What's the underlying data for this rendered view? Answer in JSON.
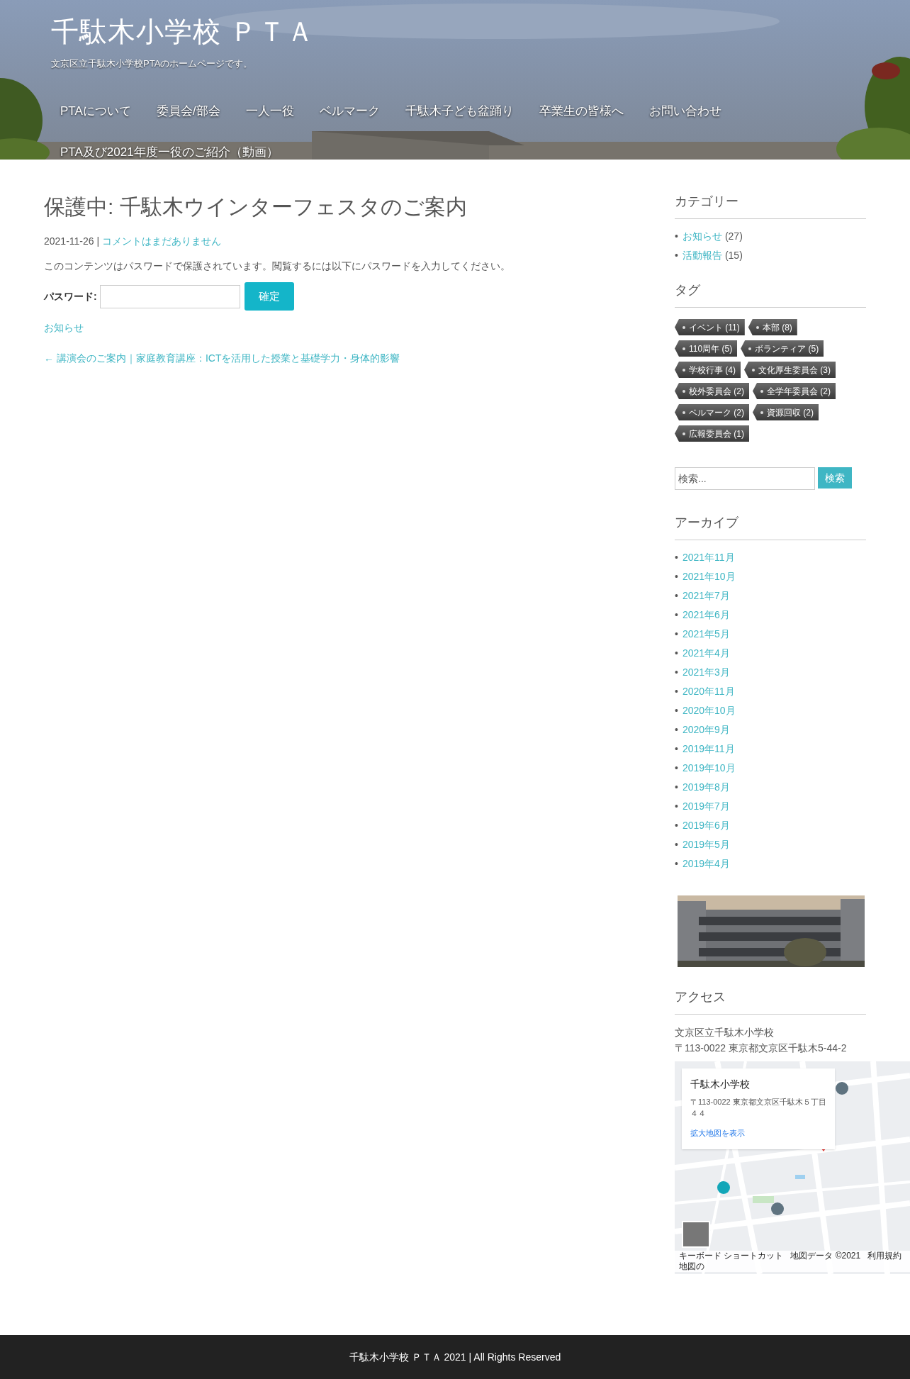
{
  "header": {
    "site_title": "千駄木小学校 ＰＴＡ",
    "tagline": "文京区立千駄木小学校PTAのホームページです。",
    "nav": [
      "PTAについて",
      "委員会/部会",
      "一人一役",
      "ベルマーク",
      "千駄木子ども盆踊り",
      "卒業生の皆様へ",
      "お問い合わせ",
      "PTA及び2021年度一役のご紹介（動画）"
    ]
  },
  "post": {
    "title": "保護中: 千駄木ウインターフェスタのご案内",
    "date": "2021-11-26",
    "separator": "|",
    "comments_link": "コメントはまだありません",
    "protected_notice": "このコンテンツはパスワードで保護されています。閲覧するには以下にパスワードを入力してください。",
    "password_label": "パスワード:",
    "submit_button": "確定",
    "category_link": "お知らせ",
    "prev_post_link": "← 講演会のご案内｜家庭教育講座：ICTを活用した授業と基礎学力・身体的影響"
  },
  "sidebar": {
    "categories": {
      "title": "カテゴリー",
      "bullet": "•",
      "items": [
        {
          "label": "お知らせ",
          "count": "(27)"
        },
        {
          "label": "活動報告",
          "count": "(15)"
        }
      ]
    },
    "tags": {
      "title": "タグ",
      "items": [
        "イベント (11)",
        "本部 (8)",
        "110周年 (5)",
        "ボランティア (5)",
        "学校行事 (4)",
        "文化厚生委員会 (3)",
        "校外委員会 (2)",
        "全学年委員会 (2)",
        "ベルマーク (2)",
        "資源回収 (2)",
        "広報委員会 (1)"
      ]
    },
    "search": {
      "placeholder": "検索...",
      "button": "検索"
    },
    "archive": {
      "title": "アーカイブ",
      "bullet": "•",
      "items": [
        "2021年11月",
        "2021年10月",
        "2021年7月",
        "2021年6月",
        "2021年5月",
        "2021年4月",
        "2021年3月",
        "2020年11月",
        "2020年10月",
        "2020年9月",
        "2019年11月",
        "2019年10月",
        "2019年8月",
        "2019年7月",
        "2019年6月",
        "2019年5月",
        "2019年4月"
      ]
    },
    "access": {
      "title": "アクセス",
      "lines": [
        "文京区立千駄木小学校",
        "〒113-0022 東京都文京区千駄木5-44-2"
      ],
      "map": {
        "info_card": {
          "title": "千駄木小学校",
          "address": "〒113-0022 東京都文京区千駄木５丁目４４",
          "link": "拡大地図を表示"
        },
        "attribution": [
          "キーボード ショートカット",
          "地図データ ©2021",
          "利用規約",
          "地図の"
        ]
      }
    }
  },
  "footer": {
    "text": "千駄木小学校 ＰＴＡ 2021 | All Rights Reserved"
  }
}
